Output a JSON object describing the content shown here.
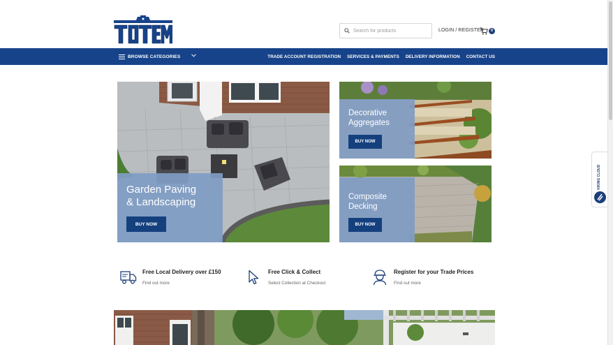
{
  "header": {
    "logo_text": "TOTEM",
    "search_placeholder": "Search for products",
    "login_label": "LOGIN / REGISTER",
    "cart_count": "0"
  },
  "nav": {
    "browse_label": "BROWSE CATEGORIES",
    "links": [
      "TRADE ACCOUNT REGISTRATION",
      "SERVICES & PAYMENTS",
      "DELIVERY INFORMATION",
      "CONTACT US"
    ]
  },
  "tiles": {
    "garden": {
      "title_line1": "Garden Paving",
      "title_line2": "& Landscaping",
      "button": "BUY NOW"
    },
    "aggregates": {
      "title_line1": "Decorative",
      "title_line2": "Aggregates",
      "button": "BUY NOW"
    },
    "decking": {
      "title_line1": "Composite",
      "title_line2": "Decking",
      "button": "BUY NOW"
    }
  },
  "features": [
    {
      "title": "Free Local Delivery over £150",
      "subtitle": "Find out more",
      "icon": "delivery-truck-icon"
    },
    {
      "title": "Free Click & Collect",
      "subtitle": "Select Collection at Checkout",
      "icon": "cursor-pointer-icon"
    },
    {
      "title": "Register for your Trade Prices",
      "subtitle": "Find out more",
      "icon": "worker-helmet-icon"
    }
  ],
  "widget": {
    "label": "VIKING CLOUD"
  },
  "colors": {
    "brand_blue": "#17438a",
    "panel_blue": "#809cc4",
    "button_blue": "#14407e"
  }
}
